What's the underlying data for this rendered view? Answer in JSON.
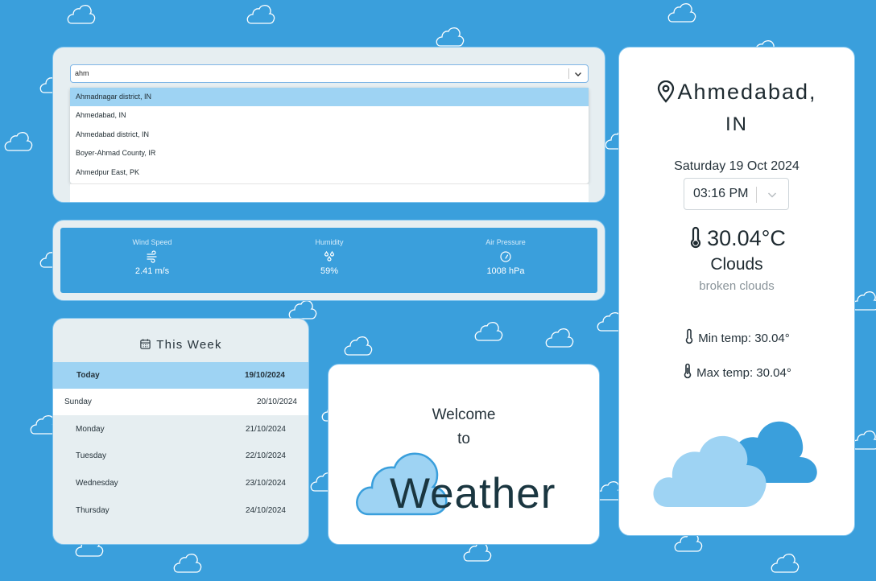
{
  "search": {
    "query": "ahm",
    "suggestions": [
      "Ahmadnagar district, IN",
      "Ahmedabad, IN",
      "Ahmedabad district, IN",
      "Boyer-Ahmad County, IR",
      "Ahmedpur East, PK"
    ]
  },
  "stats": {
    "wind": {
      "label": "Wind Speed",
      "value": "2.41 m/s",
      "icon": "wind-icon"
    },
    "humidity": {
      "label": "Humidity",
      "value": "59%",
      "icon": "humidity-icon"
    },
    "pressure": {
      "label": "Air Pressure",
      "value": "1008 hPa",
      "icon": "gauge-icon"
    }
  },
  "week": {
    "title": "This Week",
    "icon": "calendar-icon",
    "days": [
      {
        "day": "Today",
        "date": "19/10/2024"
      },
      {
        "day": "Sunday",
        "date": "20/10/2024"
      },
      {
        "day": "Monday",
        "date": "21/10/2024"
      },
      {
        "day": "Tuesday",
        "date": "22/10/2024"
      },
      {
        "day": "Wednesday",
        "date": "23/10/2024"
      },
      {
        "day": "Thursday",
        "date": "24/10/2024"
      }
    ]
  },
  "welcome": {
    "line1": "Welcome",
    "line2": "to",
    "brand": "Weather"
  },
  "current": {
    "city_line1": "Ahmedabad,",
    "city_line2": "IN",
    "date": "Saturday 19 Oct 2024",
    "time": "03:16 PM",
    "temperature": "30.04°C",
    "condition": "Clouds",
    "description": "broken clouds",
    "min_temp": "Min temp: 30.04°",
    "max_temp": "Max temp: 30.04°"
  },
  "colors": {
    "background": "#3a9fdc",
    "panel": "#e6eef1",
    "selected": "#9ed3f3",
    "text": "#25323a"
  }
}
